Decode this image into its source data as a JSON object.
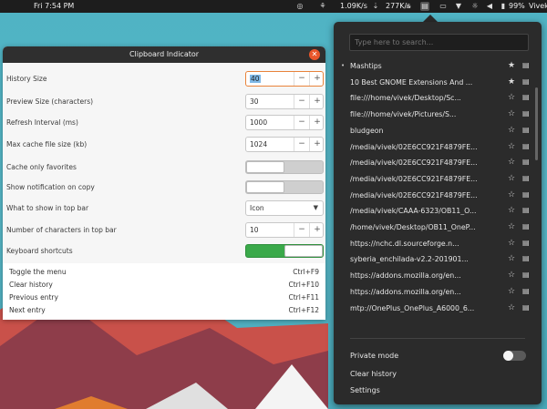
{
  "topbar": {
    "datetime": "Fri  7:54 PM",
    "download_speed": "1.09K/s",
    "upload_speed": "277K/s",
    "battery": "99%",
    "user": "Vivek"
  },
  "prefs": {
    "title": "Clipboard Indicator",
    "rows": [
      {
        "label": "History Size",
        "type": "spin",
        "value": "40",
        "focused": true
      },
      {
        "label": "Preview Size (characters)",
        "type": "spin",
        "value": "30"
      },
      {
        "label": "Refresh Interval (ms)",
        "type": "spin",
        "value": "1000"
      },
      {
        "label": "Max cache file size (kb)",
        "type": "spin",
        "value": "1024"
      },
      {
        "label": "Cache only favorites",
        "type": "toggle",
        "on": false
      },
      {
        "label": "Show notification on copy",
        "type": "toggle",
        "on": false
      },
      {
        "label": "What to show in top bar",
        "type": "select",
        "value": "Icon"
      },
      {
        "label": "Number of characters in top bar",
        "type": "spin",
        "value": "10"
      },
      {
        "label": "Keyboard shortcuts",
        "type": "toggle",
        "on": true
      }
    ],
    "shortcuts": [
      {
        "name": "Toggle the menu",
        "key": "Ctrl+F9"
      },
      {
        "name": "Clear history",
        "key": "Ctrl+F10"
      },
      {
        "name": "Previous entry",
        "key": "Ctrl+F11"
      },
      {
        "name": "Next entry",
        "key": "Ctrl+F12"
      }
    ]
  },
  "menu": {
    "search_placeholder": "Type here to search...",
    "items": [
      {
        "text": "Mashtips",
        "starred": true,
        "current": true
      },
      {
        "text": "10 Best GNOME Extensions And ...",
        "starred": true
      },
      {
        "text": "file:///home/vivek/Desktop/Sc...",
        "starred": false
      },
      {
        "text": "file:///home/vivek/Pictures/S...",
        "starred": false
      },
      {
        "text": "bludgeon",
        "starred": false
      },
      {
        "text": "/media/vivek/02E6CC921F4879FE...",
        "starred": false
      },
      {
        "text": "/media/vivek/02E6CC921F4879FE...",
        "starred": false
      },
      {
        "text": "/media/vivek/02E6CC921F4879FE...",
        "starred": false
      },
      {
        "text": "/media/vivek/02E6CC921F4879FE...",
        "starred": false
      },
      {
        "text": "/media/vivek/CAAA-6323/OB11_O...",
        "starred": false
      },
      {
        "text": "/home/vivek/Desktop/OB11_OneP...",
        "starred": false
      },
      {
        "text": "https://nchc.dl.sourceforge.n...",
        "starred": false
      },
      {
        "text": "syberia_enchilada-v2.2-201901...",
        "starred": false
      },
      {
        "text": "https://addons.mozilla.org/en...",
        "starred": false
      },
      {
        "text": "https://addons.mozilla.org/en...",
        "starred": false
      },
      {
        "text": "mtp://OnePlus_OnePlus_A6000_6...",
        "starred": false
      }
    ],
    "private_mode_label": "Private mode",
    "private_mode_on": false,
    "clear_history_label": "Clear history",
    "settings_label": "Settings"
  }
}
